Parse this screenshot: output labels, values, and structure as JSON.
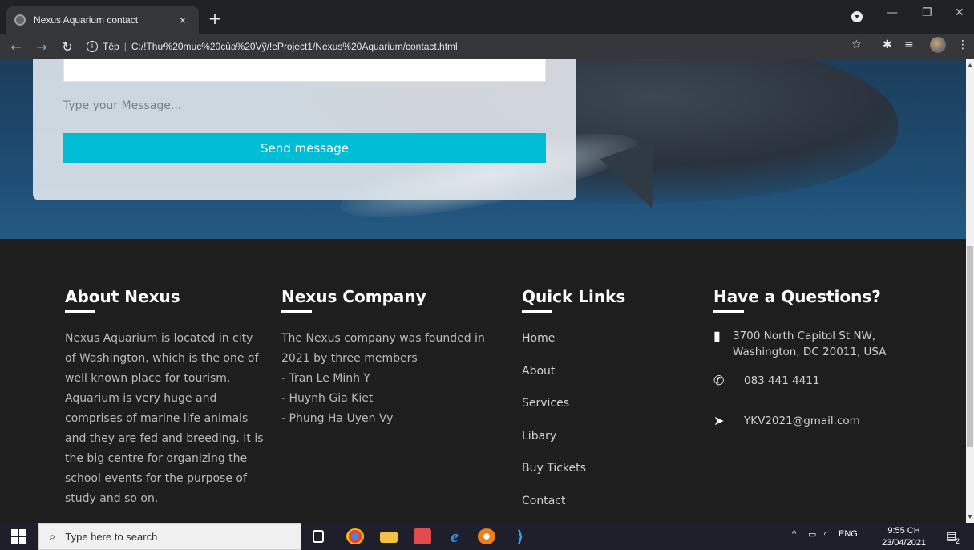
{
  "browser": {
    "tab_title": "Nexus Aquarium contact",
    "tab_close": "×",
    "new_tab": "+",
    "address_prefix": "Tệp",
    "address_separator": "|",
    "url": "C:/!Thư%20mục%20của%20Vỹ/!eProject1/Nexus%20Aquarium/contact.html",
    "window_controls": [
      "—",
      "❐",
      "✕"
    ]
  },
  "contact_form": {
    "message_placeholder": "Type your Message...",
    "send_label": "Send message"
  },
  "footer": {
    "about": {
      "title": "About Nexus",
      "text": "Nexus Aquarium is located in city of Washington, which is the one of well known place for tourism. Aquarium is very huge and comprises of marine life animals and they are fed and breeding. It is the big centre for organizing the school events for the purpose of study and so on."
    },
    "company": {
      "title": "Nexus Company",
      "lines": [
        "The Nexus company was founded in 2021 by three members",
        "- Tran Le Minh Y",
        "- Huynh Gia Kiet",
        "- Phung Ha Uyen Vy"
      ]
    },
    "quick_links": {
      "title": "Quick Links",
      "items": [
        "Home",
        "About",
        "Services",
        "Libary",
        "Buy Tickets",
        "Contact"
      ]
    },
    "questions": {
      "title": "Have a Questions?",
      "address": "3700 North Capitol St NW, Washington, DC 20011, USA",
      "phone": "083 441 4411",
      "email": "YKV2021@gmail.com"
    }
  },
  "taskbar": {
    "search_placeholder": "Type here to search",
    "language": "ENG",
    "time": "9:55 CH",
    "date": "23/04/2021",
    "notification_count": "2"
  },
  "colors": {
    "accent": "#00bcd4",
    "footer_bg": "#1e1e1e"
  }
}
